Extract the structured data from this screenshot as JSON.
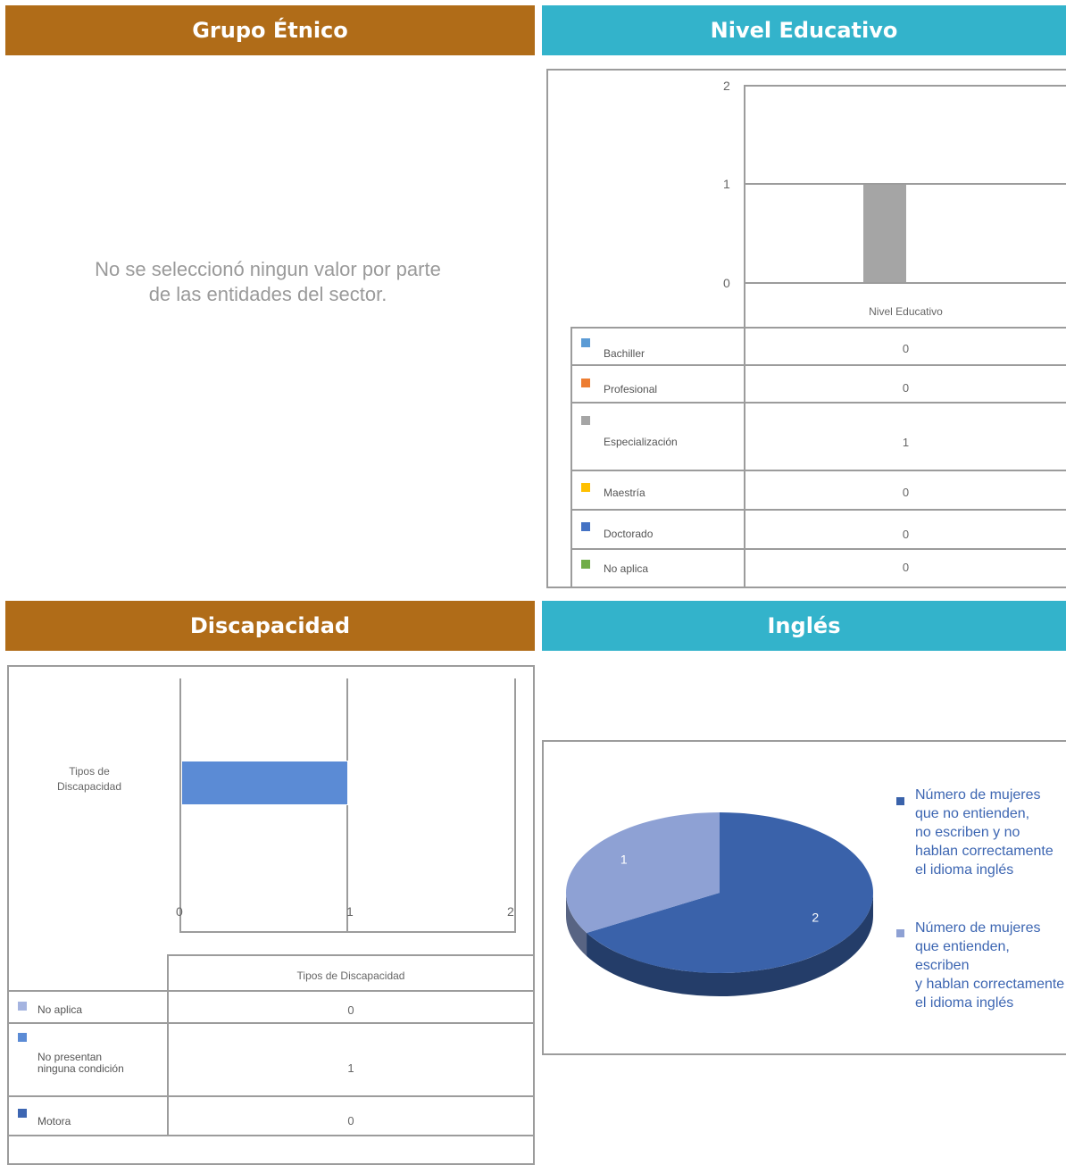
{
  "headers": {
    "grupo_etnico": "Grupo Étnico",
    "nivel_educativo": "Nivel Educativo",
    "discapacidad": "Discapacidad",
    "ingles": "Inglés"
  },
  "grupo_etnico": {
    "message_line1": "No se seleccionó ningun valor por parte",
    "message_line2": "de las entidades del sector."
  },
  "chart_data": [
    {
      "type": "bar",
      "orientation": "vertical",
      "category_label": "Nivel Educativo",
      "ylim": [
        0,
        2
      ],
      "y_ticks": [
        "2",
        "1",
        "0"
      ],
      "series": [
        {
          "name": "Bachiller",
          "color": "#5b9bd5",
          "value": 0,
          "value_label": "0"
        },
        {
          "name": "Profesional",
          "color": "#ed7d31",
          "value": 0,
          "value_label": "0"
        },
        {
          "name": "Especialización",
          "color": "#a5a5a5",
          "value": 1,
          "value_label": "1"
        },
        {
          "name": "Maestría",
          "color": "#ffc000",
          "value": 0,
          "value_label": "0"
        },
        {
          "name": "Doctorado",
          "color": "#4472c4",
          "value": 0,
          "value_label": "0"
        },
        {
          "name": "No aplica",
          "color": "#70ad47",
          "value": 0,
          "value_label": "0"
        }
      ]
    },
    {
      "type": "bar",
      "orientation": "horizontal",
      "category_label_line1": "Tipos de",
      "category_label_line2": "Discapacidad",
      "table_header": "Tipos de Discapacidad",
      "xlim": [
        0,
        2
      ],
      "x_ticks": [
        "0",
        "1",
        "2"
      ],
      "series": [
        {
          "name": "No aplica",
          "color": "#a5b4e0",
          "value": 0,
          "value_label": "0"
        },
        {
          "name_line1": "No presentan",
          "name_line2": "ninguna condición",
          "color": "#5b8bd5",
          "value": 1,
          "value_label": "1"
        },
        {
          "name": "Motora",
          "color": "#3d66b2",
          "value": 0,
          "value_label": "0"
        }
      ]
    },
    {
      "type": "pie",
      "slices": [
        {
          "value": 2,
          "value_label": "2",
          "color": "#3a62aa",
          "legend_lines": [
            "Número de mujeres",
            "que no entienden,",
            "no escriben y no",
            "hablan correctamente",
            "el idioma inglés"
          ]
        },
        {
          "value": 1,
          "value_label": "1",
          "color": "#8ea1d4",
          "legend_lines": [
            "Número de mujeres",
            "que entienden, escriben",
            "y hablan correctamente",
            "el idioma inglés"
          ]
        }
      ]
    }
  ]
}
